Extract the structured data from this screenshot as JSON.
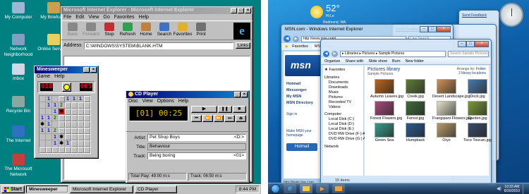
{
  "win95": {
    "desktop_icons": [
      {
        "label": "My Computer",
        "color": "#9bb7d4"
      },
      {
        "label": "My Briefcase",
        "color": "#c8a050"
      },
      {
        "label": "Network Neighborhood",
        "color": "#7fa0c0"
      },
      {
        "label": "Online Services",
        "color": "#e8d060"
      },
      {
        "label": "Inbox",
        "color": "#d0d8e8"
      },
      {
        "label": "Recycle Bin",
        "color": "#8aa8a0"
      },
      {
        "label": "The Internet",
        "color": "#3070c0"
      },
      {
        "label": "The Microsoft Network",
        "color": "#c04040"
      }
    ],
    "ie": {
      "title": "Microsoft Internet Explorer - Microsoft Internet Explorer",
      "menus": [
        "File",
        "Edit",
        "View",
        "Go",
        "Favorites",
        "Help"
      ],
      "tools": [
        "Back",
        "Forward",
        "Stop",
        "Refresh",
        "Home",
        "Search",
        "Favorites",
        "Print"
      ],
      "address_label": "Address",
      "address_value": "C:\\WINDOWS\\SYSTEM\\BLANK.HTM",
      "links_label": "Links"
    },
    "minesweeper": {
      "title": "Minesweeper",
      "menus": [
        "Game",
        "Help"
      ],
      "mine_count": "010",
      "timer": "005",
      "grid": [
        [
          "",
          "1",
          "",
          "",
          "1",
          "1",
          "1",
          ""
        ],
        [
          "",
          "1",
          "1",
          "2",
          "",
          "",
          "",
          ""
        ],
        [
          "",
          "",
          "1",
          "*",
          "",
          "",
          "",
          ""
        ],
        [
          "1",
          "1",
          "2",
          "",
          "",
          "",
          "",
          ""
        ],
        [
          "*",
          "1",
          "",
          "",
          "",
          "",
          "",
          ""
        ],
        [
          "1",
          "1",
          "2",
          "",
          "",
          "",
          "",
          ""
        ],
        [
          "",
          "",
          "1",
          "*",
          "",
          "",
          "",
          ""
        ],
        [
          "",
          "",
          "1",
          "*",
          "1",
          "",
          "",
          ""
        ],
        [
          "",
          "",
          "",
          "",
          "",
          "",
          "",
          ""
        ]
      ]
    },
    "cdplayer": {
      "title": "CD Player",
      "menus": [
        "Disc",
        "View",
        "Options",
        "Help"
      ],
      "display": "[01] 00:25",
      "artist_label": "Artist:",
      "artist": "Pet Shop Boys",
      "artist_drive": "<D:>",
      "title_label": "Title:",
      "title_value": "Behaviour",
      "track_label": "Track:",
      "track": "Being boring",
      "track_num": "<01>",
      "total_play": "Total Play: 49:00 m:s",
      "track_time": "Track: 06:50 m:s"
    },
    "taskbar": {
      "start": "Start",
      "items": [
        "Minesweeper",
        "Microsoft Internet Explorer",
        "CD Player"
      ],
      "clock": "8:44 PM"
    }
  },
  "win7": {
    "weather": {
      "temp": "52°",
      "range": "Hi  Lo",
      "location": "Redmond, WA"
    },
    "ie_title": "MSN.com - Windows Internet Explorer",
    "address": "http://www.msn.com/",
    "live_search": "Live Search",
    "feedback": "Send Feedback",
    "favorites": "Favorites",
    "msn_tab": "MSN.com",
    "msn_logo": "msn",
    "msn_links": [
      "Hotmail",
      "Messenger",
      "My MSN",
      "MSN Directory"
    ],
    "signin": "Sign in",
    "make_msn": "Make MSN your homepage",
    "hotmail_btn": "Hotmail",
    "status_url": "http://login.live.com",
    "explorer": {
      "breadcrumb": "▸ Libraries ▸ Pictures ▸ Sample Pictures",
      "search": "Search Sample Pictures",
      "toolbar": [
        "Organize",
        "Share with",
        "Slide show",
        "Burn",
        "New folder"
      ],
      "library_title": "Pictures library",
      "library_sub": "Sample Pictures",
      "arrange": "Arrange by:",
      "arrange_val": "Folder",
      "nav_favorites": "Favorites",
      "nav_libraries": "Libraries",
      "nav_lib_items": [
        "Documents",
        "Downloads",
        "Music",
        "Pictures",
        "Recorded TV",
        "Videos"
      ],
      "nav_computer": "Computer",
      "nav_comp_items": [
        "Local Disk (C:)",
        "Local Disk (D:)",
        "Local Disk (E:)",
        "DVD RW Drive (F:) Audio",
        "DVD RW Drive (G:) Audio"
      ],
      "nav_network": "Network",
      "count": "2 library locations",
      "items_count": "15 items",
      "pictures": [
        {
          "name": "Autumn Leaves.jpg",
          "color": "#b8651f"
        },
        {
          "name": "Creek.jpg",
          "color": "#5f7a3a"
        },
        {
          "name": "Desert Landscape.jpg",
          "color": "#c9915a"
        },
        {
          "name": "Dock.jpg",
          "color": "#4a78a8"
        },
        {
          "name": "Forest Flowers.jpg",
          "color": "#a64a7a"
        },
        {
          "name": "Forest.jpg",
          "color": "#3f6a3a"
        },
        {
          "name": "Frangipani Flowers.jpg",
          "color": "#e4e0c8"
        },
        {
          "name": "Garden.jpg",
          "color": "#7a9a3a"
        },
        {
          "name": "Green Sea",
          "color": "#3a9a8a"
        },
        {
          "name": "Humpback",
          "color": "#2a5a8a"
        },
        {
          "name": "Oryx",
          "color": "#b89a6a"
        },
        {
          "name": "Toco Toucan.jpg",
          "color": "#3a4a6a"
        }
      ]
    },
    "taskbar": {
      "time": "10:33 AM",
      "date": "8/30/2010"
    }
  }
}
